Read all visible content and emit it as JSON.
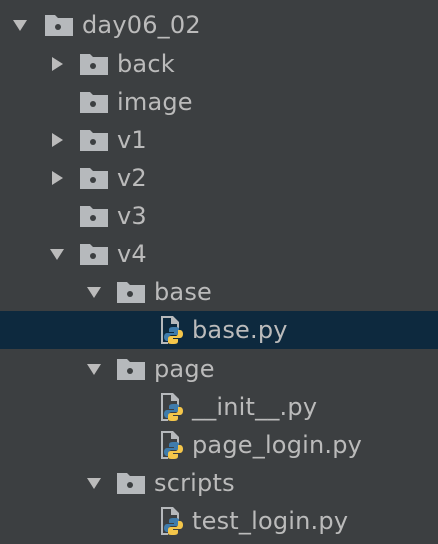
{
  "colors": {
    "background": "#3c3f41",
    "selected_row": "#0d293e",
    "text": "#bbbbbb",
    "folder": "#b6b9bc",
    "python_blue": "#3f7cac",
    "python_yellow": "#f4c64a"
  },
  "tree": [
    {
      "label": "day06_02",
      "type": "folder",
      "expanded": true,
      "depth": 0,
      "icon": "folder-icon"
    },
    {
      "label": "back",
      "type": "folder",
      "expanded": false,
      "depth": 1,
      "icon": "folder-icon"
    },
    {
      "label": "image",
      "type": "folder",
      "expanded": null,
      "depth": 1,
      "icon": "folder-icon"
    },
    {
      "label": "v1",
      "type": "folder",
      "expanded": false,
      "depth": 1,
      "icon": "folder-icon"
    },
    {
      "label": "v2",
      "type": "folder",
      "expanded": false,
      "depth": 1,
      "icon": "folder-icon"
    },
    {
      "label": "v3",
      "type": "folder",
      "expanded": null,
      "depth": 1,
      "icon": "folder-icon"
    },
    {
      "label": "v4",
      "type": "folder",
      "expanded": true,
      "depth": 1,
      "icon": "folder-icon"
    },
    {
      "label": "base",
      "type": "folder",
      "expanded": true,
      "depth": 2,
      "icon": "folder-icon"
    },
    {
      "label": "base.py",
      "type": "file",
      "depth": 3,
      "icon": "python-file-icon",
      "selected": true
    },
    {
      "label": "page",
      "type": "folder",
      "expanded": true,
      "depth": 2,
      "icon": "folder-icon"
    },
    {
      "label": "__init__.py",
      "type": "file",
      "depth": 3,
      "icon": "python-file-icon"
    },
    {
      "label": "page_login.py",
      "type": "file",
      "depth": 3,
      "icon": "python-file-icon"
    },
    {
      "label": "scripts",
      "type": "folder",
      "expanded": true,
      "depth": 2,
      "icon": "folder-icon"
    },
    {
      "label": "test_login.py",
      "type": "file",
      "depth": 3,
      "icon": "python-file-icon"
    }
  ]
}
